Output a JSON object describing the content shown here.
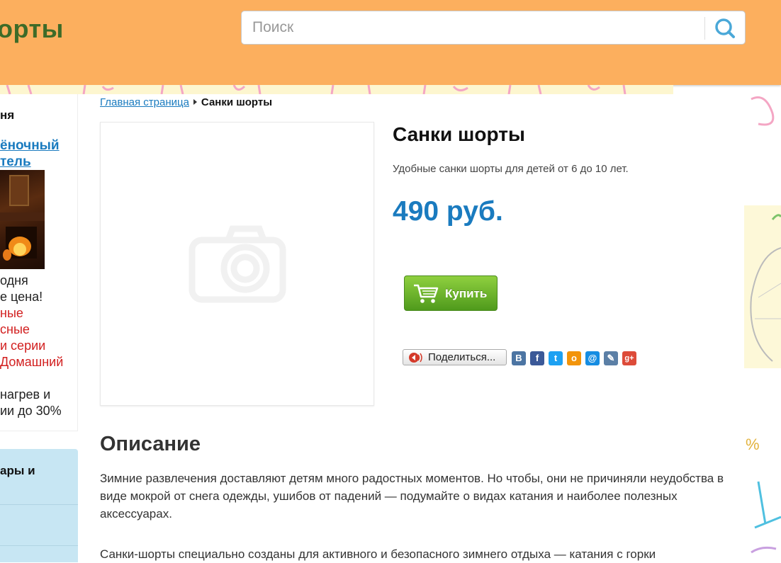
{
  "header": {
    "site_title": "орты",
    "search_placeholder": "Поиск"
  },
  "sidebar": {
    "title": "ня",
    "link_line1": "ёночный",
    "link_line2": "тель",
    "text_lines": [
      {
        "text": "одня",
        "color": "#222222"
      },
      {
        "text": "е цена!",
        "color": "#222222"
      },
      {
        "text": "ные",
        "color": "#d21f1f"
      },
      {
        "text": "сные",
        "color": "#d21f1f"
      },
      {
        "text": "и серии",
        "color": "#d21f1f"
      },
      {
        "text": "Домашний",
        "color": "#d21f1f"
      },
      {
        "text": "нагрев и",
        "color": "#222222"
      },
      {
        "text": "ии до 30%",
        "color": "#222222"
      }
    ],
    "card2_title_line1": "ары и"
  },
  "breadcrumb": {
    "home": "Главная страница",
    "current": "Санки шорты"
  },
  "product": {
    "title": "Санки шорты",
    "subtitle": "Удобные санки шорты для детей от 6 до 10 лет.",
    "price": "490 руб.",
    "buy_label": "Купить",
    "share_label": "Поделиться..."
  },
  "social_icons": [
    {
      "name": "vk-icon",
      "glyph": "B",
      "color": "#4c75a3"
    },
    {
      "name": "facebook-icon",
      "glyph": "f",
      "color": "#3b5998"
    },
    {
      "name": "twitter-icon",
      "glyph": "t",
      "color": "#1da1f2"
    },
    {
      "name": "odnoklassniki-icon",
      "glyph": "o",
      "color": "#f2940a"
    },
    {
      "name": "mailru-icon",
      "glyph": "@",
      "color": "#168de2"
    },
    {
      "name": "livejournal-icon",
      "glyph": "✎",
      "color": "#5b7fa6"
    },
    {
      "name": "googleplus-icon",
      "glyph": "g+",
      "color": "#dd4b39"
    }
  ],
  "description": {
    "heading": "Описание",
    "paragraph1": "Зимние развлечения доставляют детям много радостных моментов. Но чтобы, они не причиняли неудобства в виде мокрой от снега одежды, ушибов от падений — подумайте о видах катания и наиболее полезных аксессуарах.",
    "paragraph2": "Санки-шорты специально созданы для активного и безопасного зимнего отдыха — катания с горки"
  }
}
